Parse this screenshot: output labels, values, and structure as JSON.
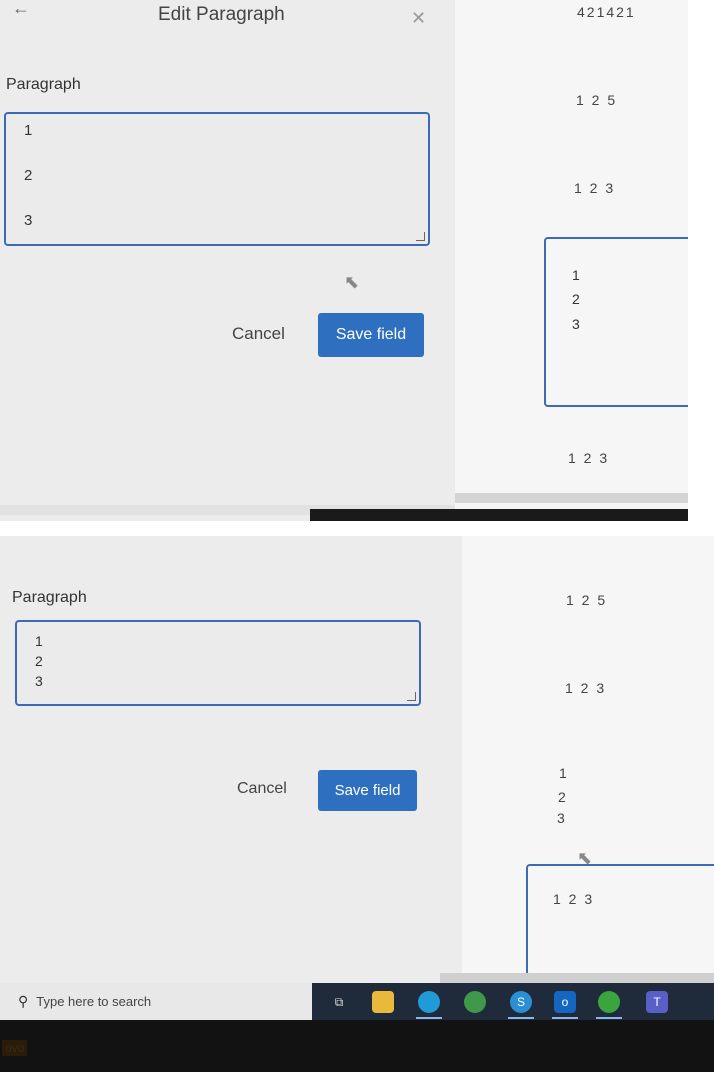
{
  "top": {
    "header": {
      "back_icon": "arrow-left-icon",
      "title": "Edit Paragraph",
      "close_icon": "close-icon",
      "side_value": "421421"
    },
    "form": {
      "label": "Paragraph",
      "lines": [
        "1",
        "2",
        "3"
      ],
      "cancel_label": "Cancel",
      "save_label": "Save field"
    },
    "side": {
      "value_a": "1 2 5",
      "value_b": "1 2 3",
      "box_lines": [
        "1",
        "2",
        "3"
      ],
      "value_c": "1 2 3"
    }
  },
  "bottom": {
    "form": {
      "label": "Paragraph",
      "lines": [
        "1",
        "2",
        "3"
      ],
      "cancel_label": "Cancel",
      "save_label": "Save field"
    },
    "side": {
      "value_a": "1 2 5",
      "value_b": "1 2 3",
      "lines": [
        "1",
        "2",
        "3"
      ],
      "box_value": "1 2 3"
    },
    "taskbar": {
      "search_placeholder": "Type here to search",
      "icons": [
        "task-view-icon",
        "file-explorer-icon",
        "edge-icon",
        "chrome-icon",
        "skype-icon",
        "outlook-icon",
        "settings-icon",
        "teams-icon"
      ]
    },
    "brand_text": "ovo"
  },
  "colors": {
    "accent": "#2f6fc0",
    "border": "#3a6ab8",
    "taskbar": "#1f2a3a"
  }
}
